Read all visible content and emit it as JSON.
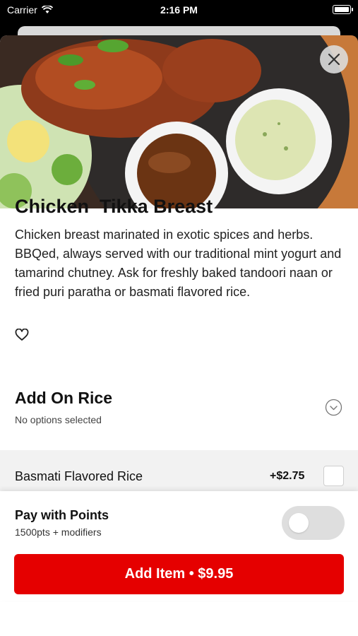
{
  "status_bar": {
    "carrier": "Carrier",
    "time": "2:16 PM"
  },
  "item": {
    "title": "Chicken  Tikka Breast",
    "description": "Chicken breast marinated in exotic spices and herbs. BBQed, always served with our traditional mint yogurt and tamarind chutney. Ask for freshly baked tandoori naan or fried puri paratha or basmati flavored rice."
  },
  "addon_section": {
    "title": "Add On Rice",
    "subtitle": "No options selected",
    "options": [
      {
        "label": "Basmati Flavored Rice",
        "price": "+$2.75",
        "selected": false
      }
    ]
  },
  "pay_with_points": {
    "title": "Pay with Points",
    "subtitle": "1500pts + modifiers",
    "enabled": false
  },
  "add_button": {
    "label": "Add Item • $9.95"
  },
  "colors": {
    "primary_button": "#e50000",
    "toggle_off": "#dedede"
  },
  "icons": [
    "wifi-icon",
    "battery-icon",
    "close-icon",
    "heart-icon",
    "chevron-down-icon",
    "checkbox-icon"
  ]
}
